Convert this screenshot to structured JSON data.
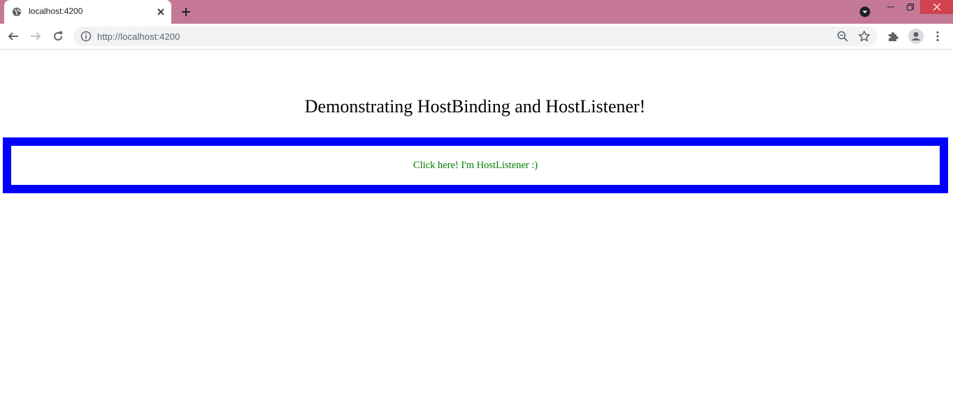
{
  "browser": {
    "tab_title": "localhost:4200",
    "url": "http://localhost:4200",
    "colors": {
      "tabstrip": "#c57896",
      "close_button": "#d0424e"
    },
    "icons": {
      "favicon": "globe-icon",
      "tab_close": "close-icon",
      "new_tab": "plus-icon",
      "profile_dropdown": "chevron-down-icon",
      "back": "back-arrow-icon",
      "forward": "forward-arrow-icon",
      "reload": "reload-icon",
      "site_info": "info-icon",
      "zoom": "zoom-out-icon",
      "bookmark": "star-icon",
      "extensions": "puzzle-icon",
      "profile": "avatar-icon",
      "menu": "kebab-menu-icon"
    }
  },
  "page": {
    "heading": "Demonstrating HostBinding and HostListener!",
    "host_listener_text": "Click here! I'm HostListener :)",
    "colors": {
      "border": "#0000ff",
      "text": "#008000"
    }
  }
}
